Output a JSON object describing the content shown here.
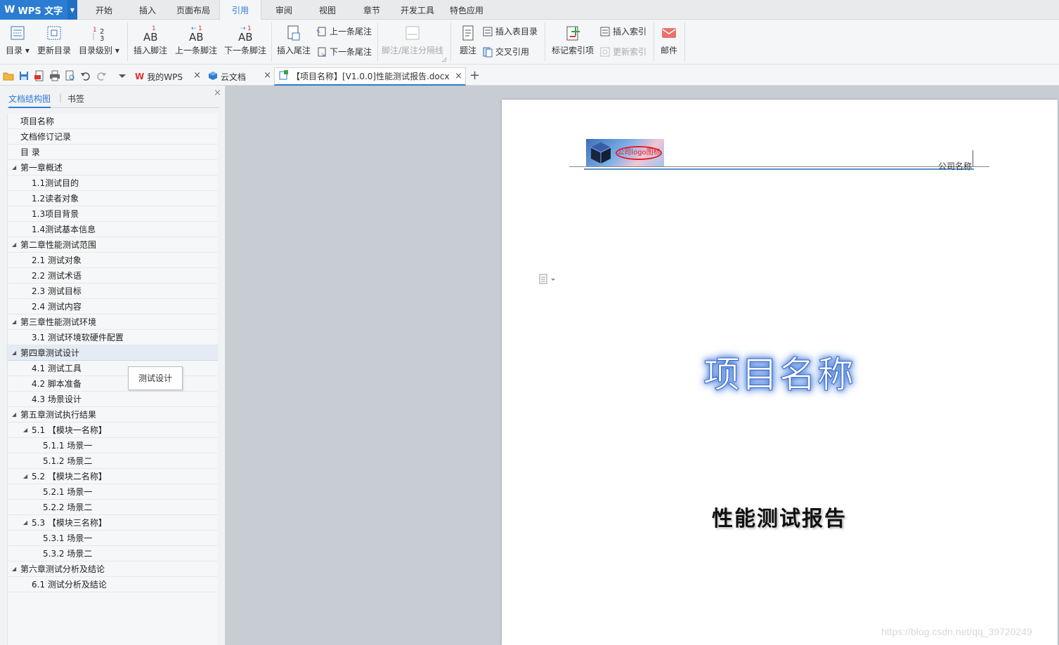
{
  "app": {
    "name": "WPS 文字",
    "logo": "W"
  },
  "menu": {
    "tabs": [
      {
        "label": "开始"
      },
      {
        "label": "插入"
      },
      {
        "label": "页面布局"
      },
      {
        "label": "引用"
      },
      {
        "label": "审阅"
      },
      {
        "label": "视图"
      },
      {
        "label": "章节"
      },
      {
        "label": "开发工具"
      },
      {
        "label": "特色应用"
      }
    ],
    "active": "引用"
  },
  "ribbon": {
    "toc": "目录",
    "update_toc": "更新目录",
    "toc_level": "目录级别",
    "insert_footnote": "插入脚注",
    "prev_footnote": "上一条脚注",
    "next_footnote": "下一条脚注",
    "insert_endnote": "插入尾注",
    "prev_endnote": "上一条尾注",
    "next_endnote": "下一条尾注",
    "separator": "脚注/尾注分隔线",
    "caption": "题注",
    "insert_table_of_figures": "插入表目录",
    "cross_reference": "交叉引用",
    "mark_index": "标记索引项",
    "insert_index": "插入索引",
    "update_index": "更新索引",
    "mail": "邮件"
  },
  "doc_tabs": [
    {
      "label": "我的WPS"
    },
    {
      "label": "云文档"
    },
    {
      "label": "【项目名称】[V1.0.0]性能测试报告.docx"
    }
  ],
  "panel": {
    "tab_structure": "文档结构图",
    "tab_bookmark": "书签",
    "tooltip": "测试设计",
    "items": [
      {
        "label": "项目名称",
        "level": 0,
        "toggle": false
      },
      {
        "label": "文档修订记录",
        "level": 0,
        "toggle": false
      },
      {
        "label": "目  录",
        "level": 0,
        "toggle": false
      },
      {
        "label": "第一章概述",
        "level": 0,
        "toggle": true
      },
      {
        "label": "1.1测试目的",
        "level": 1,
        "toggle": false
      },
      {
        "label": "1.2读者对象",
        "level": 1,
        "toggle": false
      },
      {
        "label": "1.3项目背景",
        "level": 1,
        "toggle": false
      },
      {
        "label": "1.4测试基本信息",
        "level": 1,
        "toggle": false
      },
      {
        "label": "第二章性能测试范围",
        "level": 0,
        "toggle": true
      },
      {
        "label": "2.1  测试对象",
        "level": 1,
        "toggle": false
      },
      {
        "label": "2.2  测试术语",
        "level": 1,
        "toggle": false
      },
      {
        "label": "2.3  测试目标",
        "level": 1,
        "toggle": false
      },
      {
        "label": "2.4  测试内容",
        "level": 1,
        "toggle": false
      },
      {
        "label": "第三章性能测试环境",
        "level": 0,
        "toggle": true
      },
      {
        "label": "3.1  测试环境软硬件配置",
        "level": 1,
        "toggle": false
      },
      {
        "label": "第四章测试设计",
        "level": 0,
        "toggle": true,
        "selected": true
      },
      {
        "label": "4.1  测试工具",
        "level": 1,
        "toggle": false
      },
      {
        "label": "4.2  脚本准备",
        "level": 1,
        "toggle": false
      },
      {
        "label": "4.3  场景设计",
        "level": 1,
        "toggle": false
      },
      {
        "label": "第五章测试执行结果",
        "level": 0,
        "toggle": true
      },
      {
        "label": "5.1  【模块一名称】",
        "level": 1,
        "toggle": true
      },
      {
        "label": "5.1.1  场景一",
        "level": 2,
        "toggle": false
      },
      {
        "label": "5.1.2  场景二",
        "level": 2,
        "toggle": false
      },
      {
        "label": "5.2  【模块二名称】",
        "level": 1,
        "toggle": true
      },
      {
        "label": "5.2.1  场景一",
        "level": 2,
        "toggle": false
      },
      {
        "label": "5.2.2  场景二",
        "level": 2,
        "toggle": false
      },
      {
        "label": "5.3  【模块三名称】",
        "level": 1,
        "toggle": true
      },
      {
        "label": "5.3.1  场景一",
        "level": 2,
        "toggle": false
      },
      {
        "label": "5.3.2  场景二",
        "level": 2,
        "toggle": false
      },
      {
        "label": "第六章测试分析及结论",
        "level": 0,
        "toggle": true
      },
      {
        "label": "6.1  测试分析及结论",
        "level": 1,
        "toggle": false
      }
    ]
  },
  "document": {
    "logo_text": "公司logo图标",
    "company": "公司名称",
    "title": "项目名称",
    "subtitle": "性能测试报告"
  },
  "watermark": "https://blog.csdn.net/qq_39720249",
  "colors": {
    "accent": "#2b7cd3",
    "title_glow": "#4a86e8"
  }
}
